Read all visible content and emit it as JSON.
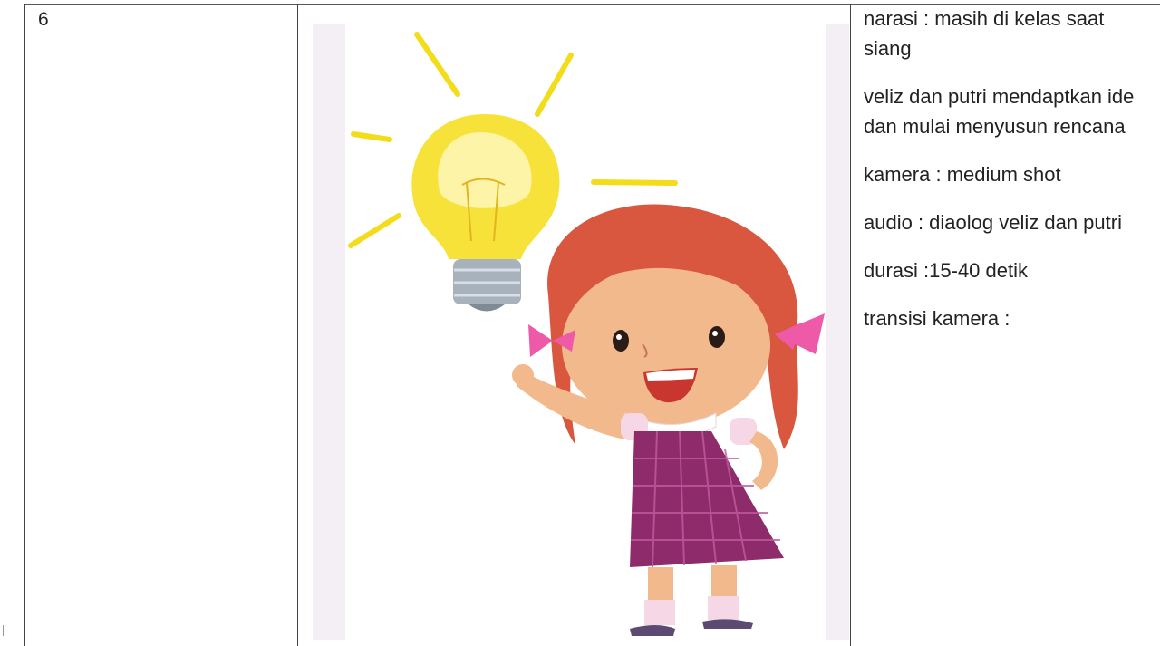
{
  "row": {
    "scene_number": "6",
    "description": [
      "narasi : masih di kelas saat siang",
      "veliz dan putri mendaptkan ide dan mulai menyusun rencana",
      "kamera : medium shot",
      "audio : diaolog veliz dan putri",
      "durasi :15-40 detik",
      "transisi kamera :"
    ]
  },
  "illustration": {
    "subject": "girl pointing at light bulb idea illustration",
    "colors": {
      "bulb": "#f7e23a",
      "bulb_glow": "#fdf4a8",
      "hair": "#d9563f",
      "dress": "#8e2b6b",
      "bow": "#ef5aa8",
      "skin": "#f2b98c"
    }
  }
}
